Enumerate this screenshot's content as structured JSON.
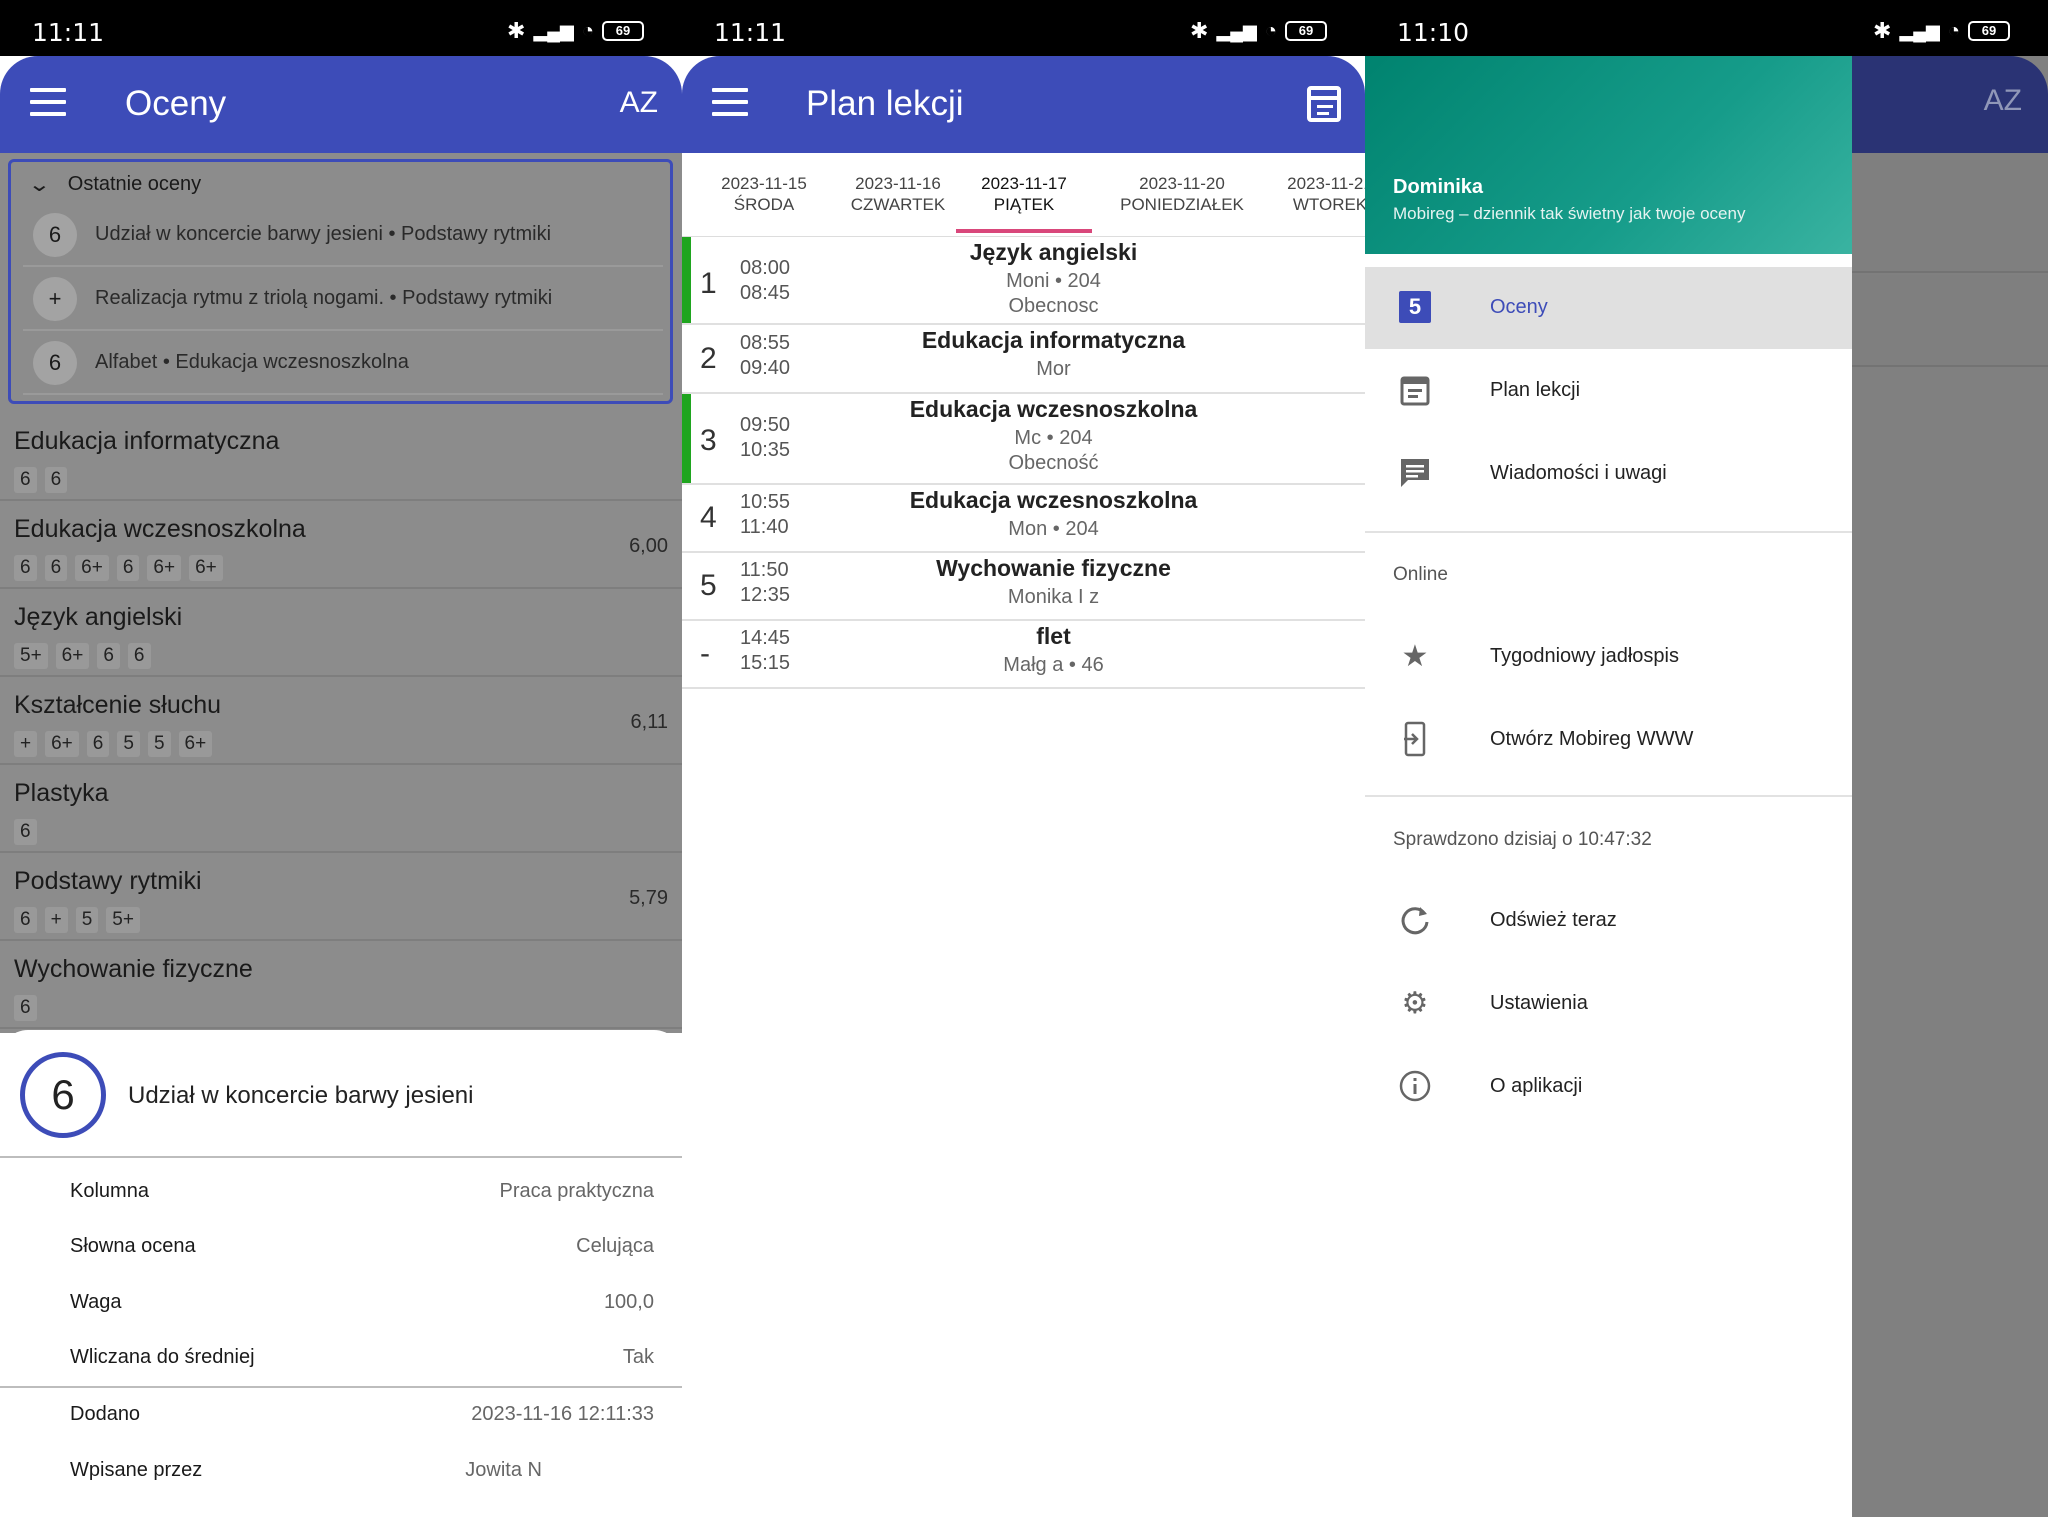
{
  "status": [
    {
      "time": "11:11",
      "battery": "69"
    },
    {
      "time": "11:11",
      "battery": "69"
    },
    {
      "time": "11:10",
      "battery": "69"
    }
  ],
  "grades_screen": {
    "title": "Oceny",
    "sort_label": "AZ",
    "recent_header": "Ostatnie oceny",
    "recent": [
      {
        "grade": "6",
        "text": "Udział w koncercie barwy jesieni • Podstawy rytmiki"
      },
      {
        "grade": "+",
        "text": "Realizacja rytmu z triolą nogami. • Podstawy rytmiki"
      },
      {
        "grade": "6",
        "text": "Alfabet • Edukacja wczesnoszkolna"
      }
    ],
    "subjects": [
      {
        "name": "Edukacja informatyczna",
        "grades": [
          "6",
          "6"
        ],
        "avg": ""
      },
      {
        "name": "Edukacja wczesnoszkolna",
        "grades": [
          "6",
          "6",
          "6+",
          "6",
          "6+",
          "6+"
        ],
        "avg": "6,00"
      },
      {
        "name": "Język angielski",
        "grades": [
          "5+",
          "6+",
          "6",
          "6"
        ],
        "avg": ""
      },
      {
        "name": "Kształcenie słuchu",
        "grades": [
          "+",
          "6+",
          "6",
          "5",
          "5",
          "6+"
        ],
        "avg": "6,11"
      },
      {
        "name": "Plastyka",
        "grades": [
          "6"
        ],
        "avg": ""
      },
      {
        "name": "Podstawy rytmiki",
        "grades": [
          "6",
          "+",
          "5",
          "5+"
        ],
        "avg": "5,79"
      },
      {
        "name": "Wychowanie fizyczne",
        "grades": [
          "6"
        ],
        "avg": ""
      }
    ],
    "detail": {
      "grade": "6",
      "title": "Udział w koncercie barwy jesieni",
      "rows": [
        {
          "key": "Kolumna",
          "value": "Praca praktyczna"
        },
        {
          "key": "Słowna ocena",
          "value": "Celująca"
        },
        {
          "key": "Waga",
          "value": "100,0"
        },
        {
          "key": "Wliczana do średniej",
          "value": "Tak"
        }
      ],
      "rows2": [
        {
          "key": "Dodano",
          "value": "2023-11-16 12:11:33"
        },
        {
          "key": "Wpisane przez",
          "value": "Jowita N"
        }
      ]
    }
  },
  "plan_screen": {
    "title": "Plan lekcji",
    "tabs": [
      {
        "date": "2023-11-15",
        "day": "ŚRODA"
      },
      {
        "date": "2023-11-16",
        "day": "CZWARTEK"
      },
      {
        "date": "2023-11-17",
        "day": "PIĄTEK"
      },
      {
        "date": "2023-11-20",
        "day": "PONIEDZIAŁEK"
      },
      {
        "date": "2023-11-21",
        "day": "WTOREK"
      }
    ],
    "lessons": [
      {
        "num": "1",
        "start": "08:00",
        "end": "08:45",
        "subject": "Język angielski",
        "teacher": "Moni         • 204",
        "attendance": "Obecnosc"
      },
      {
        "num": "2",
        "start": "08:55",
        "end": "09:40",
        "subject": "Edukacja informatyczna",
        "teacher": "Mor",
        "attendance": ""
      },
      {
        "num": "3",
        "start": "09:50",
        "end": "10:35",
        "subject": "Edukacja wczesnoszkolna",
        "teacher": "Mc          • 204",
        "attendance": "Obecność"
      },
      {
        "num": "4",
        "start": "10:55",
        "end": "11:40",
        "subject": "Edukacja wczesnoszkolna",
        "teacher": "Mon           • 204",
        "attendance": ""
      },
      {
        "num": "5",
        "start": "11:50",
        "end": "12:35",
        "subject": "Wychowanie fizyczne",
        "teacher": "Monika I          z",
        "attendance": ""
      },
      {
        "num": "-",
        "start": "14:45",
        "end": "15:15",
        "subject": "flet",
        "teacher": "Małg                              a • 46",
        "attendance": ""
      }
    ]
  },
  "drawer": {
    "background_sort_label": "AZ",
    "user_name": "Dominika",
    "tagline": "Mobireg – dziennik tak świetny jak twoje oceny",
    "items_main": [
      {
        "label": "Oceny",
        "icon": "grade-5-icon",
        "badge": "5"
      },
      {
        "label": "Plan lekcji",
        "icon": "calendar-icon"
      },
      {
        "label": "Wiadomości i uwagi",
        "icon": "message-icon"
      }
    ],
    "section_online": "Online",
    "items_online": [
      {
        "label": "Tygodniowy jadłospis",
        "icon": "star-icon"
      },
      {
        "label": "Otwórz Mobireg WWW",
        "icon": "open-in-phone-icon"
      }
    ],
    "checked_text": "Sprawdzono dzisiaj o 10:47:32",
    "items_sys": [
      {
        "label": "Odśwież teraz",
        "icon": "refresh-icon"
      },
      {
        "label": "Ustawienia",
        "icon": "gear-icon"
      },
      {
        "label": "O aplikacji",
        "icon": "info-icon"
      }
    ]
  }
}
